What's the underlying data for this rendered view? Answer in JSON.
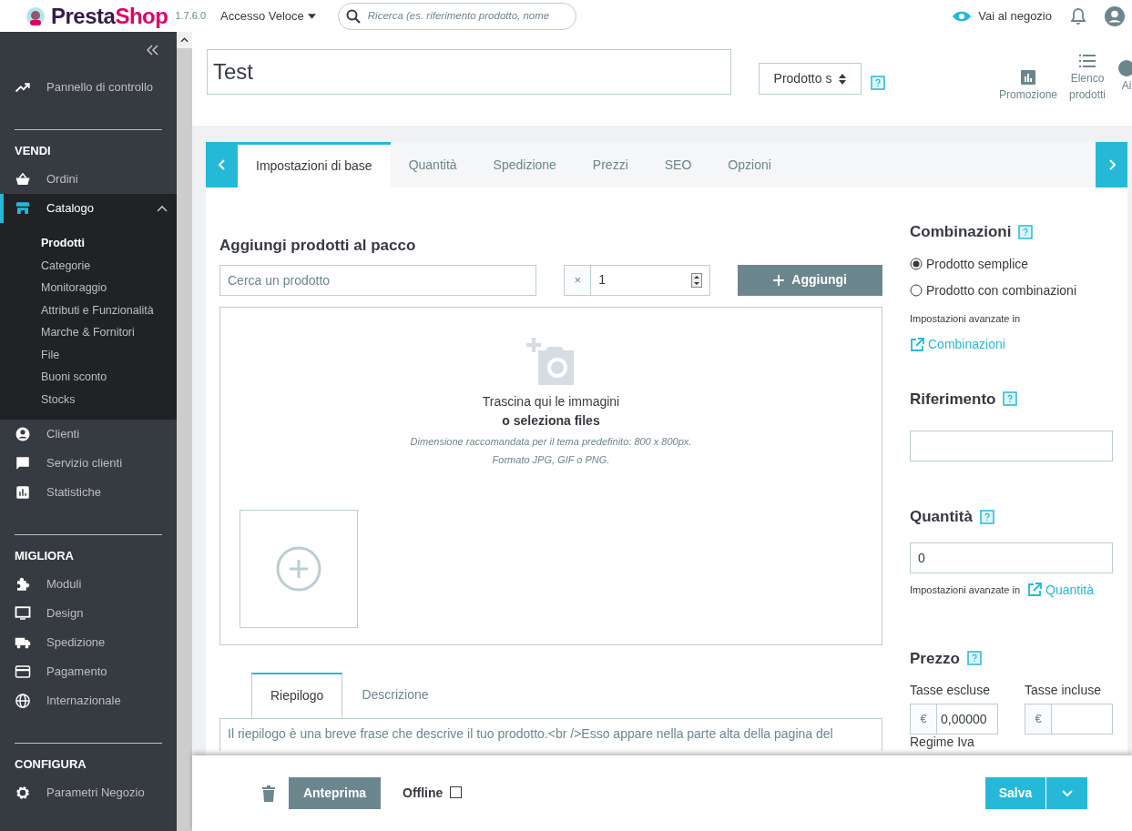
{
  "header": {
    "logo": [
      "Presta",
      "Shop"
    ],
    "version": "1.7.6.0",
    "quick_access": "Accesso Veloce",
    "search": {
      "placeholder": "Ricerca (es. riferimento prodotto, nome"
    },
    "store_link": "Vai al negozio"
  },
  "sidebar": {
    "top_items": [
      {
        "label": "Pannello di controllo",
        "selected": false,
        "expanded": false
      }
    ],
    "sections": [
      {
        "title": "VENDI",
        "items": [
          {
            "label": "Ordini",
            "selected": false,
            "expanded": false
          },
          {
            "label": "Catalogo",
            "selected": true,
            "expanded": true,
            "children": [
              {
                "label": "Prodotti",
                "selected": true
              },
              {
                "label": "Categorie",
                "selected": false
              },
              {
                "label": "Monitoraggio",
                "selected": false
              },
              {
                "label": "Attributi e Funzionalità",
                "selected": false
              },
              {
                "label": "Marche & Fornitori",
                "selected": false
              },
              {
                "label": "File",
                "selected": false
              },
              {
                "label": "Buoni sconto",
                "selected": false
              },
              {
                "label": "Stocks",
                "selected": false
              }
            ]
          },
          {
            "label": "Clienti",
            "selected": false,
            "expanded": false
          },
          {
            "label": "Servizio clienti",
            "selected": false,
            "expanded": false
          },
          {
            "label": "Statistiche",
            "selected": false,
            "expanded": false
          }
        ]
      },
      {
        "title": "MIGLIORA",
        "items": [
          {
            "label": "Moduli",
            "selected": false,
            "expanded": false
          },
          {
            "label": "Design",
            "selected": false,
            "expanded": false
          },
          {
            "label": "Spedizione",
            "selected": false,
            "expanded": false
          },
          {
            "label": "Pagamento",
            "selected": false,
            "expanded": false
          },
          {
            "label": "Internazionale",
            "selected": false,
            "expanded": false
          }
        ]
      },
      {
        "title": "CONFIGURA",
        "items": [
          {
            "label": "Parametri Negozio",
            "selected": false,
            "expanded": false
          }
        ]
      }
    ]
  },
  "product": {
    "name": "Test",
    "type": "Prodotto s"
  },
  "toolbar": [
    {
      "label": "Promozione"
    },
    {
      "label": "Elenco prodotti"
    },
    {
      "label": "Ai"
    }
  ],
  "tabs": [
    {
      "label": "Impostazioni di base",
      "selected": true
    },
    {
      "label": "Quantità",
      "selected": false
    },
    {
      "label": "Spedizione",
      "selected": false
    },
    {
      "label": "Prezzi",
      "selected": false
    },
    {
      "label": "SEO",
      "selected": false
    },
    {
      "label": "Opzioni",
      "selected": false
    }
  ],
  "pack": {
    "title": "Aggiungi prodotti al pacco",
    "search": {
      "placeholder": "Cerca un prodotto"
    },
    "qty_prefix": "×",
    "qty": "1",
    "add_button": "Aggiungi"
  },
  "dropzone": {
    "line_1": "Trascina qui le immagini",
    "line_2": "o seleziona files",
    "hint_1": "Dimensione raccomandata per il tema predefinito: 800 x 800px.",
    "hint_2": "Formato JPG, GIF o PNG."
  },
  "summary_tabs": [
    {
      "label": "Riepilogo",
      "selected": true
    },
    {
      "label": "Descrizione",
      "selected": false
    }
  ],
  "summary_text": "Il riepilogo è una breve frase che descrive il tuo prodotto.<br />Esso appare nella parte alta della pagina del",
  "combinations": {
    "title": "Combinazioni",
    "options": [
      {
        "label": "Prodotto semplice",
        "selected": true
      },
      {
        "label": "Prodotto con combinazioni",
        "selected": false
      }
    ],
    "advanced": "Impostazioni avanzate in",
    "link": "Combinazioni"
  },
  "reference": {
    "title": "Riferimento"
  },
  "quantity": {
    "title": "Quantità",
    "value": "0",
    "advanced": "Impostazioni avanzate in",
    "link": "Quantità"
  },
  "price": {
    "title": "Prezzo",
    "fields": [
      {
        "label": "Tasse escluse",
        "currency": "€",
        "value": "0,00000"
      },
      {
        "label": "Tasse incluse",
        "currency": "€"
      }
    ],
    "tax_rule": "Regime Iva"
  },
  "footer": {
    "preview_button": "Anteprima",
    "offline": {
      "label": "Offline",
      "checked": false
    },
    "save_button": "Salva"
  }
}
